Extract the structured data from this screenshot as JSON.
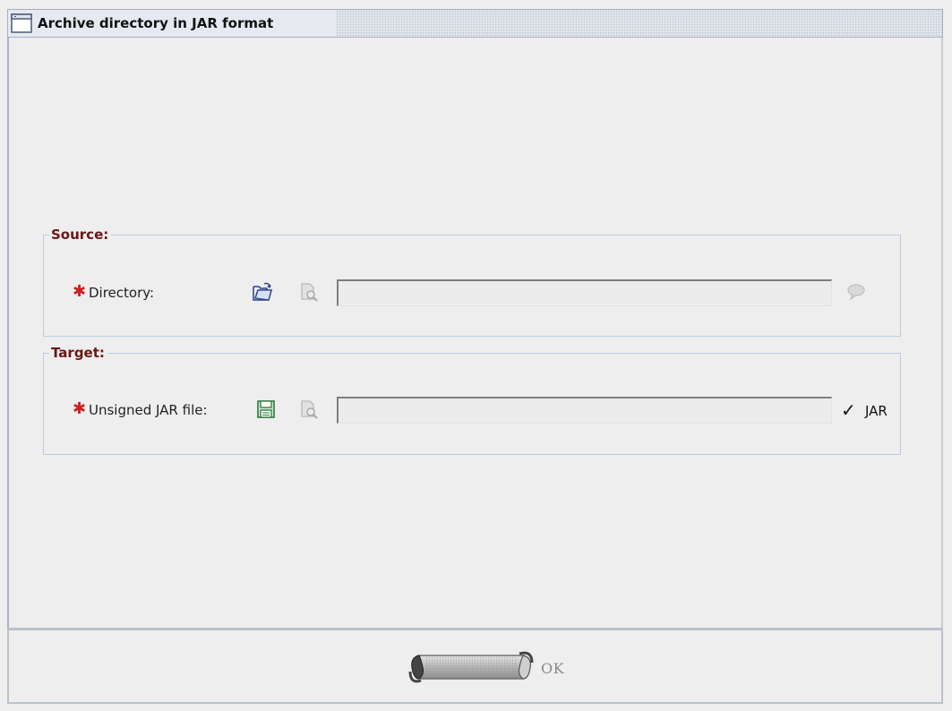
{
  "window": {
    "title": "Archive directory in JAR format"
  },
  "source": {
    "title": "Source:",
    "directory": {
      "required_mark": "✱",
      "label": "Directory:",
      "value": "",
      "open_icon": "folder-open-icon",
      "browse_icon": "document-search-icon",
      "comment_icon": "speech-bubble-icon"
    }
  },
  "target": {
    "title": "Target:",
    "jar_file": {
      "required_mark": "✱",
      "label": "Unsigned JAR file:",
      "value": "",
      "save_icon": "floppy-save-icon",
      "browse_icon": "document-search-icon",
      "check_mark": "✓",
      "extension": "JAR"
    }
  },
  "buttons": {
    "ok_label": "OK"
  },
  "colors": {
    "group_title": "#6b1515",
    "required": "#cc2020",
    "group_border": "#b8cbe0",
    "background": "#eeeeee"
  }
}
